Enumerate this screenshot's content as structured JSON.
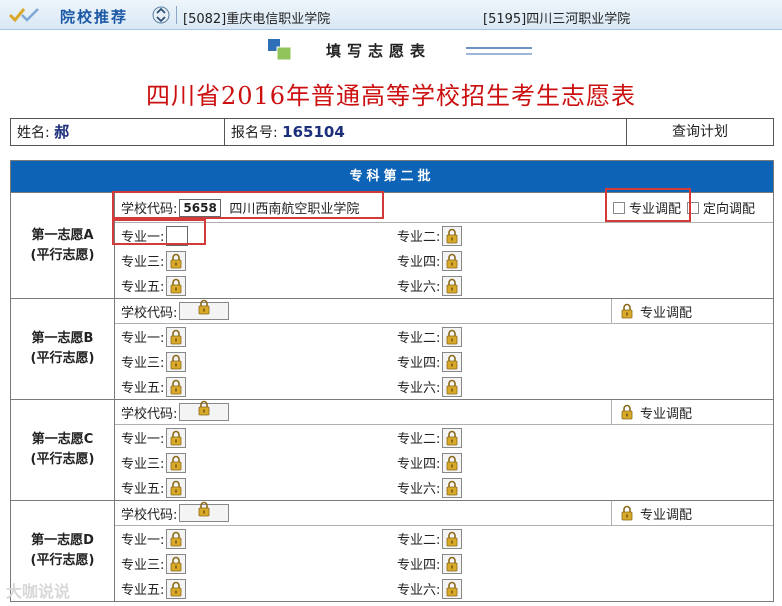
{
  "topbar": {
    "title": "院校推荐",
    "rec_a": "[5082]重庆电信职业学院",
    "rec_b": "[5195]四川三河职业学院"
  },
  "form_heading": "填写志愿表",
  "main_title": "四川省2016年普通高等学校招生考生志愿表",
  "info": {
    "name_label": "姓名:",
    "name_value": "郝",
    "reg_label": "报名号:",
    "reg_value": "165104",
    "query_button": "查询计划"
  },
  "batch": {
    "header": "专科第二批",
    "choices": [
      {
        "label": "第一志愿A",
        "sub": "(平行志愿)",
        "school_code_label": "学校代码:",
        "school_code": "5658",
        "school_name": "四川西南航空职业学院",
        "adjust_label": "专业调配",
        "directed_label": "定向调配",
        "majors": [
          "专业一:",
          "专业二:",
          "专业三:",
          "专业四:",
          "专业五:",
          "专业六:"
        ]
      },
      {
        "label": "第一志愿B",
        "sub": "(平行志愿)",
        "school_code_label": "学校代码:",
        "adjust_label": "专业调配",
        "majors": [
          "专业一:",
          "专业二:",
          "专业三:",
          "专业四:",
          "专业五:",
          "专业六:"
        ]
      },
      {
        "label": "第一志愿C",
        "sub": "(平行志愿)",
        "school_code_label": "学校代码:",
        "adjust_label": "专业调配",
        "majors": [
          "专业一:",
          "专业二:",
          "专业三:",
          "专业四:",
          "专业五:",
          "专业六:"
        ]
      },
      {
        "label": "第一志愿D",
        "sub": "(平行志愿)",
        "school_code_label": "学校代码:",
        "adjust_label": "专业调配",
        "majors": [
          "专业一:",
          "专业二:",
          "专业三:",
          "专业四:",
          "专业五:",
          "专业六:"
        ]
      }
    ]
  },
  "watermark": "大咖说说",
  "colors": {
    "header_blue": "#0d63b5",
    "title_red": "#cc1010",
    "highlight_red": "#d33a3a"
  }
}
